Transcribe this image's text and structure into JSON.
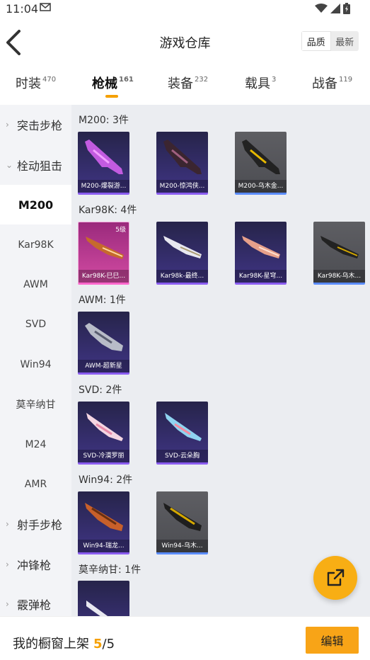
{
  "status": {
    "time": "11:04"
  },
  "header": {
    "title": "游戏仓库",
    "sort_quality": "品质",
    "sort_latest": "最新"
  },
  "tabs": [
    {
      "label": "时装",
      "count": "470"
    },
    {
      "label": "枪械",
      "count": "161"
    },
    {
      "label": "装备",
      "count": "232"
    },
    {
      "label": "载具",
      "count": "3"
    },
    {
      "label": "战备",
      "count": "119"
    }
  ],
  "sidebar": {
    "groups": [
      "突击步枪",
      "栓动狙击",
      "射手步枪",
      "冲锋枪",
      "霰弹枪"
    ],
    "items": [
      "M200",
      "Kar98K",
      "AWM",
      "SVD",
      "Win94",
      "莫辛纳甘",
      "M24",
      "AMR"
    ]
  },
  "sections": [
    {
      "title": "M200: 3件",
      "cards": [
        "M200-爆裂游...",
        "M200-惊鸿侠...",
        "M200-乌木金..."
      ]
    },
    {
      "title": "Kar98K: 4件",
      "level": "5级",
      "cards": [
        "Kar98K-巳巳...",
        "Kar98k-最终...",
        "Kar98K-星穹...",
        "Kar98K-乌木..."
      ]
    },
    {
      "title": "AWM: 1件",
      "cards": [
        "AWM-超新星"
      ]
    },
    {
      "title": "SVD: 2件",
      "cards": [
        "SVD-冷漠罗丽",
        "SVD-云朵胸"
      ]
    },
    {
      "title": "Win94: 2件",
      "cards": [
        "Win94-瑞龙...",
        "Win94-乌木..."
      ]
    },
    {
      "title": "莫辛纳甘: 1件",
      "cards": []
    }
  ],
  "bottom": {
    "shelf_label": "我的橱窗上架",
    "shelf_current": "5",
    "shelf_sep": "/",
    "shelf_total": "5",
    "edit": "编辑"
  },
  "colors": {
    "accent": "#f8a417",
    "purple_card": "#3f3483",
    "gray_card": "#4c4d52",
    "pink_card": "#d24aa2"
  },
  "icons": [
    "mail-icon",
    "wifi-icon",
    "signal-icon",
    "battery-icon",
    "back-arrow-icon",
    "chevron-right-icon",
    "chevron-down-icon",
    "share-icon"
  ]
}
